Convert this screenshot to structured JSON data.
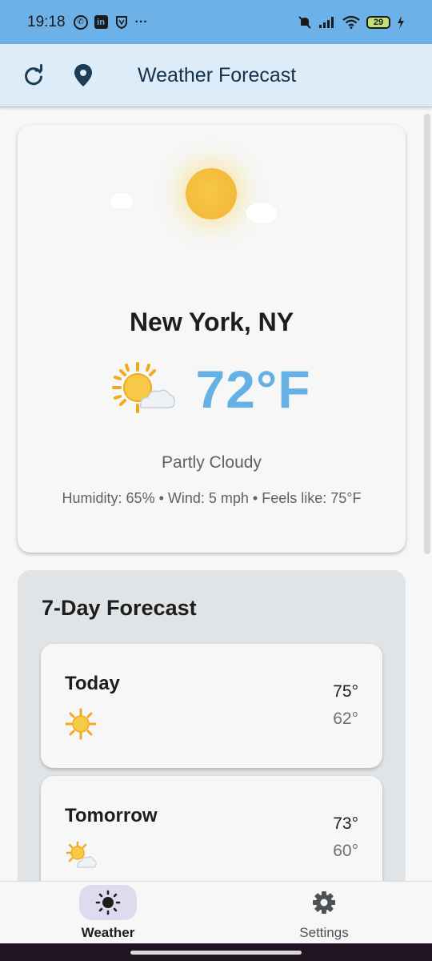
{
  "status_bar": {
    "time": "19:18",
    "left_icons": [
      "whatsapp-icon",
      "linkedin-icon",
      "vpn-icon",
      "more-dots-icon"
    ],
    "more": "···",
    "battery": "29"
  },
  "app_bar": {
    "title": "Weather Forecast",
    "refresh_icon": "refresh-icon",
    "location_icon": "location-pin-icon"
  },
  "current": {
    "city": "New York, NY",
    "temperature": "72°F",
    "condition": "Partly Cloudy",
    "details": "Humidity: 65% • Wind: 5 mph • Feels like: 75°F",
    "icon": "sun-behind-cloud-icon"
  },
  "forecast": {
    "title": "7-Day Forecast",
    "days": [
      {
        "name": "Today",
        "high": "75°",
        "low": "62°",
        "icon": "sun-icon"
      },
      {
        "name": "Tomorrow",
        "high": "73°",
        "low": "60°",
        "icon": "sun-behind-cloud-icon"
      }
    ]
  },
  "bottom_nav": {
    "items": [
      {
        "label": "Weather",
        "icon": "sun-icon",
        "active": true
      },
      {
        "label": "Settings",
        "icon": "gear-icon",
        "active": false
      }
    ]
  },
  "colors": {
    "status_bar": "#6cb2e8",
    "app_bar": "#dcecf8",
    "temperature": "#65b1e6",
    "nav_active_pill": "#dedbee"
  }
}
